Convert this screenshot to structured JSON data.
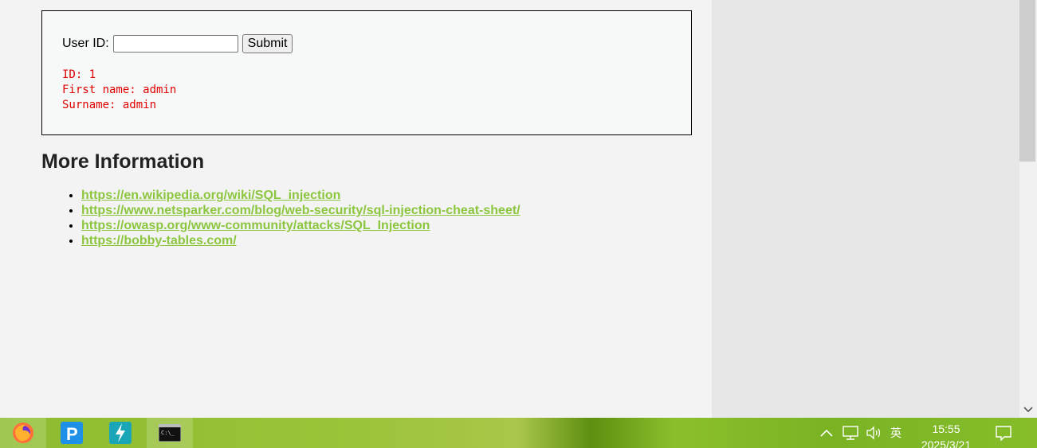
{
  "form": {
    "label": "User ID:",
    "input_value": "",
    "submit_label": "Submit"
  },
  "result": {
    "lines": [
      "ID: 1",
      "First name: admin",
      "Surname: admin"
    ]
  },
  "more_info": {
    "heading": "More Information",
    "links": [
      "https://en.wikipedia.org/wiki/SQL_injection",
      "https://www.netsparker.com/blog/web-security/sql-injection-cheat-sheet/",
      "https://owasp.org/www-community/attacks/SQL_Injection",
      "https://bobby-tables.com/"
    ]
  },
  "taskbar": {
    "apps": [
      "firefox-icon",
      "p-app-icon",
      "lightning-app-icon",
      "terminal-icon"
    ],
    "tray": {
      "ime": "英",
      "time": "15:55",
      "date": "2025/3/21"
    }
  },
  "colors": {
    "link": "#8cc63f",
    "result_text": "#e00000",
    "taskbar": "#8dbb2e"
  }
}
